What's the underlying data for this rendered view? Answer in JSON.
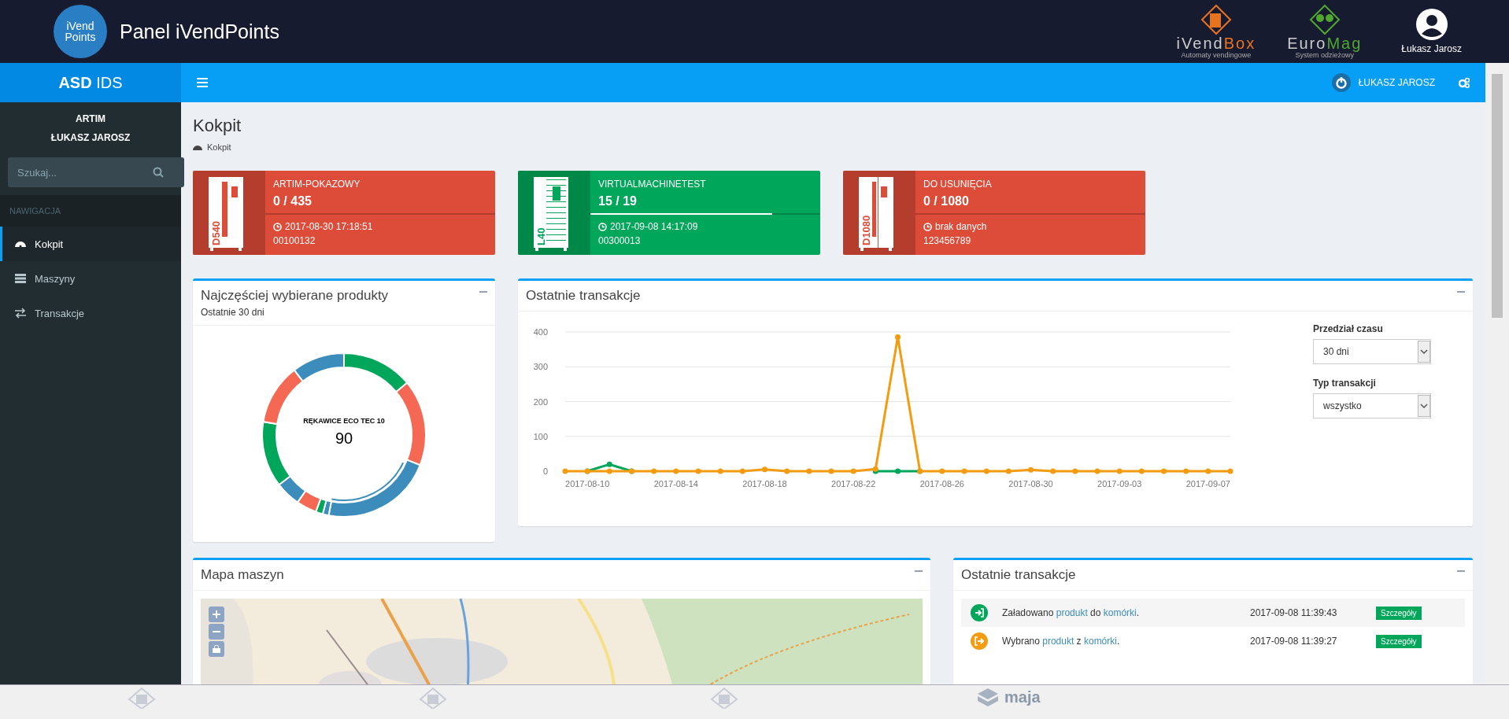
{
  "header": {
    "logo": [
      "iVend",
      "Points"
    ],
    "title": "Panel iVendPoints",
    "brands": [
      {
        "kind": "ivendbox",
        "name_parts": [
          "iVend",
          "Box"
        ],
        "tagline": "Automaty vendingowe"
      },
      {
        "kind": "euromag",
        "name_parts": [
          "Euro",
          "Mag"
        ],
        "tagline": "System odzieżowy"
      }
    ],
    "user": "Łukasz Jarosz"
  },
  "sidebar": {
    "brand": "**ASD** IDS",
    "org": "ARTIM",
    "user": "ŁUKASZ JAROSZ",
    "search": {
      "placeholder": "Szukaj..."
    },
    "nav_header": "NAWIGACJA",
    "items": [
      {
        "label": "Kokpit",
        "kind": "dashboard",
        "selected": true
      },
      {
        "label": "Maszyny",
        "kind": "server",
        "selected": false
      },
      {
        "label": "Transakcje",
        "kind": "exchange",
        "selected": false
      }
    ]
  },
  "navbar": {
    "user": "ŁUKASZ JAROSZ"
  },
  "page": {
    "title": "Kokpit",
    "breadcrumb": [
      "Kokpit"
    ]
  },
  "machines": [
    {
      "kind": "vending",
      "model": "D540",
      "name": "ARTIM-POKAZOWY",
      "count": "0 / 435",
      "level": 0,
      "time": "2017-08-30 17:18:51",
      "code": "00100132",
      "color": "#dd4b39"
    },
    {
      "kind": "locker",
      "model": "L40",
      "name": "VIRTUALMACHINETEST",
      "count": "15 / 19",
      "level": 0.79,
      "time": "2017-09-08 14:17:09",
      "code": "00300013",
      "color": "#00a65a"
    },
    {
      "kind": "double",
      "model": "D1080",
      "name": "DO USUNIĘCIA",
      "count": "0 / 1080",
      "level": 0,
      "time": "brak danych",
      "code": "123456789",
      "color": "#dd4b39"
    }
  ],
  "products_panel": {
    "title": "Najczęściej wybierane produkty",
    "subtitle": "Ostatnie 30 dni",
    "highlight": {
      "label": "RĘKAWICE ECO TEC 10",
      "value": "90"
    }
  },
  "transactions_chart": {
    "title": "Ostatnie transakcje",
    "chart_data": {
      "type": "line",
      "categories": [
        null,
        "2017-08-10",
        null,
        null,
        null,
        "2017-08-14",
        null,
        null,
        null,
        "2017-08-18",
        null,
        null,
        null,
        "2017-08-22",
        null,
        null,
        null,
        "2017-08-26",
        null,
        null,
        null,
        "2017-08-30",
        null,
        null,
        null,
        "2017-09-03",
        null,
        null,
        null,
        "2017-09-07",
        null
      ],
      "series": [
        {
          "color": "#00a65a",
          "marker": "circle",
          "values": [
            null,
            0,
            20,
            0,
            null,
            null,
            null,
            null,
            null,
            null,
            null,
            null,
            null,
            null,
            0,
            0,
            0,
            null,
            null,
            null,
            null,
            null,
            null,
            null,
            null,
            null,
            null,
            null,
            null,
            null,
            null
          ]
        },
        {
          "color": "#f39c12",
          "marker": "circle",
          "values": [
            0,
            0,
            0,
            0,
            0,
            0,
            0,
            0,
            0,
            5,
            0,
            0,
            0,
            0,
            6,
            385,
            0,
            0,
            0,
            0,
            0,
            4,
            0,
            0,
            0,
            0,
            0,
            0,
            0,
            0,
            0
          ]
        }
      ],
      "ylim": [
        0,
        400
      ],
      "yticks": [
        0,
        100,
        200,
        300,
        400
      ],
      "grid": true
    },
    "filters": [
      {
        "label": "Przedział czasu",
        "value": "30 dni"
      },
      {
        "label": "Typ transakcji",
        "value": "wszystko"
      }
    ]
  },
  "map_panel": {
    "title": "Mapa maszyn"
  },
  "recent_transactions": {
    "title": "Ostatnie transakcje",
    "rows": [
      {
        "kind": "in",
        "parts": [
          {
            "kind": "text",
            "text": "Załadowano "
          },
          {
            "kind": "link",
            "text": "produkt"
          },
          {
            "kind": "text",
            "text": " do "
          },
          {
            "kind": "link",
            "text": "komórki"
          },
          {
            "kind": "text",
            "text": "."
          }
        ],
        "time": "2017-09-08 11:39:43",
        "action": "Szczegóły"
      },
      {
        "kind": "out",
        "parts": [
          {
            "kind": "text",
            "text": "Wybrano "
          },
          {
            "kind": "link",
            "text": "produkt"
          },
          {
            "kind": "text",
            "text": " z "
          },
          {
            "kind": "link",
            "text": "komórki"
          },
          {
            "kind": "text",
            "text": "."
          }
        ],
        "time": "2017-09-08 11:39:27",
        "action": "Szczegóły"
      }
    ]
  },
  "footer": {
    "brand": "maja"
  }
}
